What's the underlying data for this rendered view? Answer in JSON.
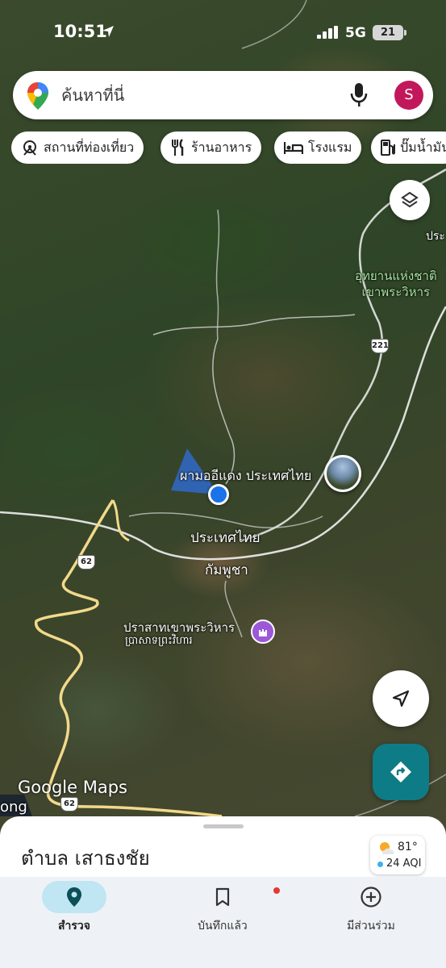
{
  "status_bar": {
    "time": "10:51",
    "network": "5G",
    "battery": "21"
  },
  "search": {
    "placeholder": "ค้นหาที่นี่",
    "avatar_letter": "S"
  },
  "chips": [
    {
      "label": "สถานที่ท่องเที่ยว",
      "icon": "attractions-icon"
    },
    {
      "label": "ร้านอาหาร",
      "icon": "restaurant-icon"
    },
    {
      "label": "โรงแรม",
      "icon": "hotel-icon"
    },
    {
      "label": "ปั๊มน้ำมัน",
      "icon": "gas-station-icon"
    }
  ],
  "map": {
    "labels": {
      "park_line1": "อุทยานแห่งชาติ",
      "park_line2": "เขาพระวิหาร",
      "cliff": "ผามออีแดง ประเทศไทย",
      "country_th": "ประเทศไทย",
      "country_kh": "กัมพูชา",
      "temple_th": "ปราสาทเขาพระวิหาร",
      "temple_kh": "ប្រាសាទព្រះវិហារ",
      "edge_partial": "ong",
      "road_top_partial": "ประ"
    },
    "route_shields": [
      "221",
      "62",
      "62"
    ],
    "watermark": "Google Maps"
  },
  "bottom_sheet": {
    "place_name": "ตำบล เสาธงชัย",
    "weather": {
      "temperature": "81°",
      "aqi": "24 AQI"
    }
  },
  "tabs": [
    {
      "label": "สำรวจ",
      "icon": "explore-pin-icon",
      "active": true
    },
    {
      "label": "บันทึกแล้ว",
      "icon": "bookmark-icon",
      "active": false
    },
    {
      "label": "มีส่วนร่วม",
      "icon": "plus-circle-icon",
      "active": false
    }
  ],
  "colors": {
    "accent_teal": "#0e7c86",
    "blue_dot": "#1a73e8",
    "avatar": "#c2185b",
    "active_tab": "#bfe6f2"
  }
}
